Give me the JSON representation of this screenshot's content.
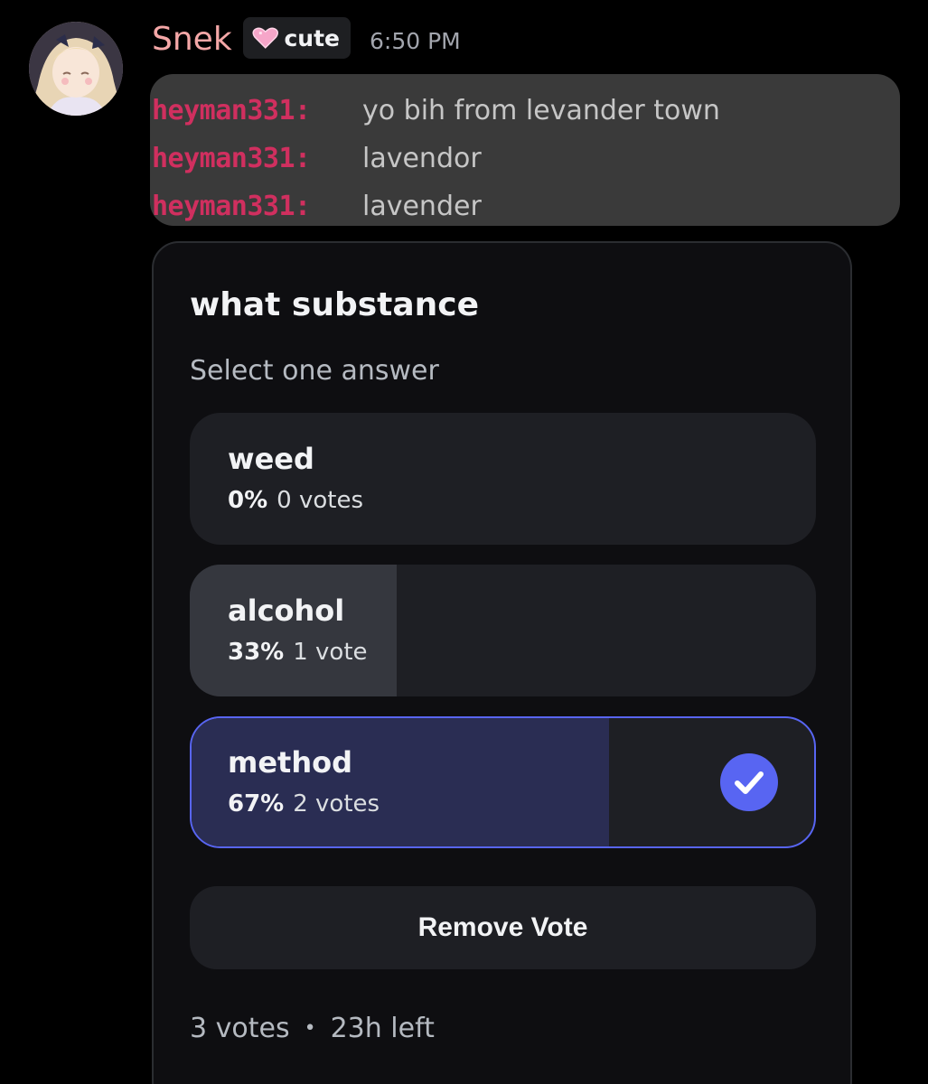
{
  "message": {
    "username": "Snek",
    "username_color": "#f4a7a7",
    "tag": {
      "icon": "heart-icon",
      "label": "cute"
    },
    "timestamp": "6:50 PM"
  },
  "chat_embed": {
    "lines": [
      {
        "user": "heyman331:",
        "text": "yo bih from levander town"
      },
      {
        "user": "heyman331:",
        "text": "lavendor"
      },
      {
        "user": "heyman331:",
        "text": "lavender"
      }
    ],
    "user_color": "#d02f5f"
  },
  "poll": {
    "question": "what substance",
    "subtitle": "Select one answer",
    "options": [
      {
        "label": "weed",
        "percent": "0%",
        "votes": "0 votes",
        "fraction": 0,
        "selected": false
      },
      {
        "label": "alcohol",
        "percent": "33%",
        "votes": "1 vote",
        "fraction": 0.33,
        "selected": false
      },
      {
        "label": "method",
        "percent": "67%",
        "votes": "2 votes",
        "fraction": 0.67,
        "selected": true
      }
    ],
    "remove_vote_label": "Remove Vote",
    "footer": {
      "total_votes": "3 votes",
      "separator": "•",
      "time_left": "23h left"
    },
    "accent_color": "#5865f2"
  }
}
